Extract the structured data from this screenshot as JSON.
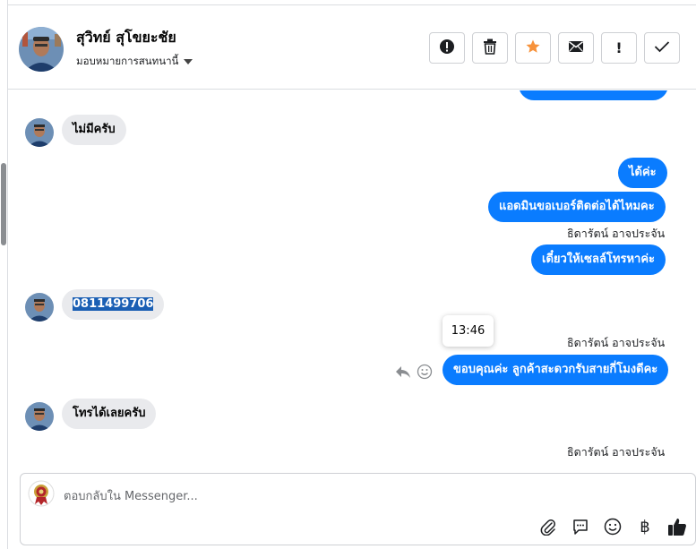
{
  "header": {
    "contact_name": "สุวิทย์ สุโขยะชัย",
    "assign_label": "มอบหมายการสนทนานี้",
    "tools": [
      {
        "icon": "alert-circle-icon"
      },
      {
        "icon": "trash-icon"
      },
      {
        "icon": "star-icon",
        "color": "#f7923b"
      },
      {
        "icon": "envelope-icon"
      },
      {
        "icon": "exclamation-icon",
        "text": "!"
      },
      {
        "icon": "checkmark-icon"
      }
    ]
  },
  "messages": {
    "in_1": "ไม่มีครับ",
    "out_1": "ได้ค่ะ",
    "out_2": "แอดมินขอเบอร์ติดต่อได้ไหมคะ",
    "sender_1": "ธิดารัตน์ อาจประจัน",
    "out_3": "เดี๋ยวให้เซลล์โทรหาค่ะ",
    "in_2": "0811499706",
    "tooltip_time": "13:46",
    "sender_2": "ธิดารัตน์ อาจประจัน",
    "out_4": "ขอบคุณค่ะ ลูกค้าสะดวกรับสายกี่โมงดีคะ",
    "in_3": "โทรได้เลยครับ",
    "sender_3": "ธิดารัตน์ อาจประจัน"
  },
  "composer": {
    "placeholder": "ตอบกลับใน Messenger...",
    "baht_symbol": "฿",
    "tools": [
      "paperclip-icon",
      "chat-bubble-icon",
      "smiley-icon",
      "baht-icon",
      "thumbs-up-icon"
    ]
  },
  "colors": {
    "outgoing_bubble": "#0a7cff",
    "incoming_bubble": "#e9eaed",
    "star": "#f7923b"
  }
}
